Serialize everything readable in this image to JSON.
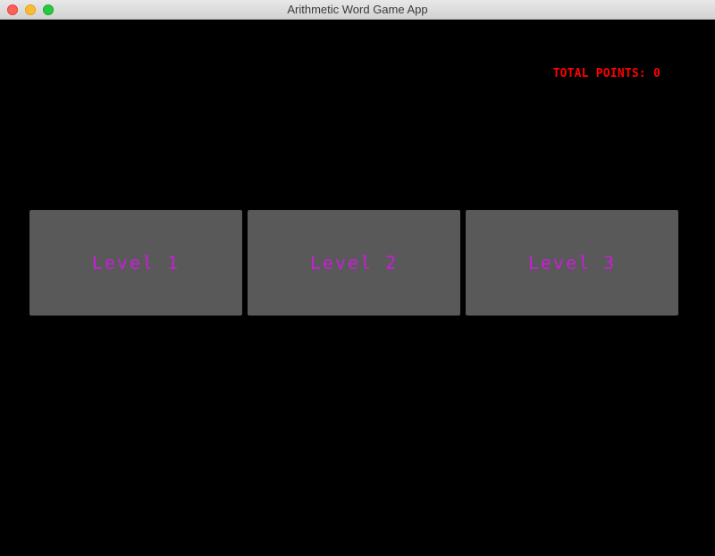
{
  "window": {
    "title": "Arithmetic Word Game App"
  },
  "header": {
    "total_points_label": "TOTAL POINTS: 0"
  },
  "levels": [
    {
      "label": "Level 1"
    },
    {
      "label": "Level 2"
    },
    {
      "label": "Level 3"
    }
  ],
  "colors": {
    "background": "#000000",
    "points_text": "#ff0000",
    "level_button_bg": "#595959",
    "level_button_text": "#c81fd6"
  }
}
